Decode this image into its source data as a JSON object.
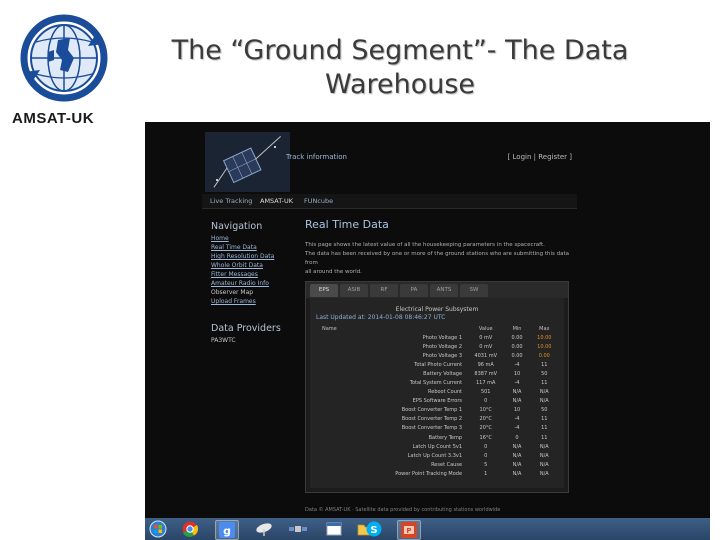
{
  "slide": {
    "title_line1": "The “Ground Segment”- The Data",
    "title_line2": "Warehouse",
    "logo_text": "AMSAT-UK"
  },
  "site": {
    "header_link": "Track information",
    "login": "[ Login | Register ]",
    "nav": [
      "Live Tracking",
      "AMSAT-UK",
      "FUNcube"
    ],
    "navigation_heading": "Navigation",
    "navigation_items": [
      "Home",
      "Real Time Data",
      "High Resolution Data",
      "Whole Orbit Data",
      "Fitter Messages",
      "Amateur Radio Info",
      "Observer Map",
      "Upload Frames"
    ],
    "providers_heading": "Data Providers",
    "providers": [
      "PA3WTC"
    ],
    "main_title": "Real Time Data",
    "main_desc": [
      "This page shows the latest value of all the housekeeping parameters in the spacecraft.",
      "The data has been received by one or more of the ground stations who are submitting this data from",
      "all around the world."
    ],
    "tabs": [
      "EPS",
      "ASIB",
      "RF",
      "PA",
      "ANTS",
      "SW"
    ],
    "panel_title": "Electrical Power Subsystem",
    "last_updated": "Last Updated at: 2014-01-08 08:46:27 UTC",
    "table": {
      "headers": [
        "Name",
        "Value",
        "Min",
        "Max"
      ],
      "rows": [
        {
          "name": "Photo Voltage 1",
          "value": "0 mV",
          "min": "0.00",
          "max": "10.00"
        },
        {
          "name": "Photo Voltage 2",
          "value": "0 mV",
          "min": "0.00",
          "max": "10.00"
        },
        {
          "name": "Photo Voltage 3",
          "value": "4031 mV",
          "min": "0.00",
          "max": "0.00"
        },
        {
          "name": "Total Photo Current",
          "value": "96 mA",
          "min": "-4",
          "max": "11"
        },
        {
          "name": "Battery Voltage",
          "value": "8387 mV",
          "min": "10",
          "max": "50"
        },
        {
          "name": "Total System Current",
          "value": "117 mA",
          "min": "-4",
          "max": "11"
        },
        {
          "name": "Reboot Count",
          "value": "501",
          "min": "N/A",
          "max": "N/A"
        },
        {
          "name": "EPS Software Errors",
          "value": "0",
          "min": "N/A",
          "max": "N/A"
        },
        {
          "name": "Boost Converter Temp 1",
          "value": "10°C",
          "min": "10",
          "max": "50"
        },
        {
          "name": "Boost Converter Temp 2",
          "value": "20°C",
          "min": "-4",
          "max": "11"
        },
        {
          "name": "Boost Converter Temp 3",
          "value": "20°C",
          "min": "-4",
          "max": "11"
        },
        {
          "name": "Battery Temp",
          "value": "16°C",
          "min": "0",
          "max": "11"
        },
        {
          "name": "Latch Up Count 5v1",
          "value": "0",
          "min": "N/A",
          "max": "N/A"
        },
        {
          "name": "Latch Up Count 3.3v1",
          "value": "0",
          "min": "N/A",
          "max": "N/A"
        },
        {
          "name": "Reset Cause",
          "value": "5",
          "min": "N/A",
          "max": "N/A"
        },
        {
          "name": "Power Point Tracking Mode",
          "value": "1",
          "min": "N/A",
          "max": "N/A"
        }
      ]
    },
    "footer": "Data © AMSAT-UK · Satellite data provided by contributing stations worldwide"
  },
  "taskbar": {
    "icons": [
      "start-orb-icon",
      "ie-icon",
      "chrome-icon",
      "google-icon",
      "satellite-dish-icon",
      "satellite-icon",
      "explorer-icon",
      "skype-icon",
      "powerpoint-icon"
    ],
    "colors": {
      "start": "#2f7fd0",
      "chrome": "#d8332a",
      "google": "#4a8cf0",
      "skype": "#00aff0",
      "powerpoint": "#d24726"
    }
  }
}
